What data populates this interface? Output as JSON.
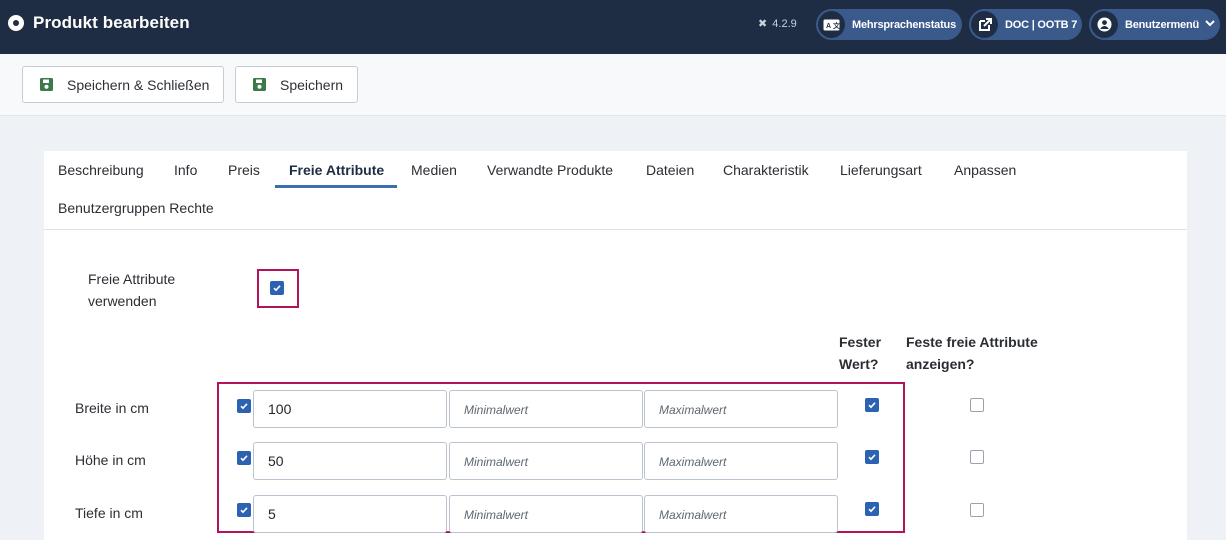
{
  "header": {
    "title": "Produkt bearbeiten",
    "version": "4.2.9",
    "multilang": "Mehrsprachenstatus",
    "doc": "DOC | OOTB 7",
    "user_menu": "Benutzermenü"
  },
  "toolbar": {
    "save_close": "Speichern & Schließen",
    "save": "Speichern"
  },
  "tabs": [
    "Beschreibung",
    "Info",
    "Preis",
    "Freie Attribute",
    "Medien",
    "Verwandte Produkte",
    "Dateien",
    "Charakteristik",
    "Lieferungsart",
    "Anpassen",
    "Benutzergruppen Rechte"
  ],
  "active_tab": "Freie Attribute",
  "form": {
    "use_label_line1": "Freie Attribute",
    "use_label_line2": "verwenden",
    "use_checked": true,
    "col_fixed_line1": "Fester",
    "col_fixed_line2": "Wert?",
    "col_show_line1": "Feste freie Attribute",
    "col_show_line2": "anzeigen?",
    "min_placeholder": "Minimalwert",
    "max_placeholder": "Maximalwert",
    "rows": [
      {
        "label": "Breite in cm",
        "enabled": true,
        "value": "100",
        "fixed": true,
        "show": false
      },
      {
        "label": "Höhe in cm",
        "enabled": true,
        "value": "50",
        "fixed": true,
        "show": false
      },
      {
        "label": "Tiefe in cm",
        "enabled": true,
        "value": "5",
        "fixed": true,
        "show": false
      }
    ]
  },
  "colors": {
    "header_bg": "#1f2d44",
    "accent": "#2b62b2",
    "highlight": "#b3125d",
    "save_icon": "#3c7a4a"
  }
}
